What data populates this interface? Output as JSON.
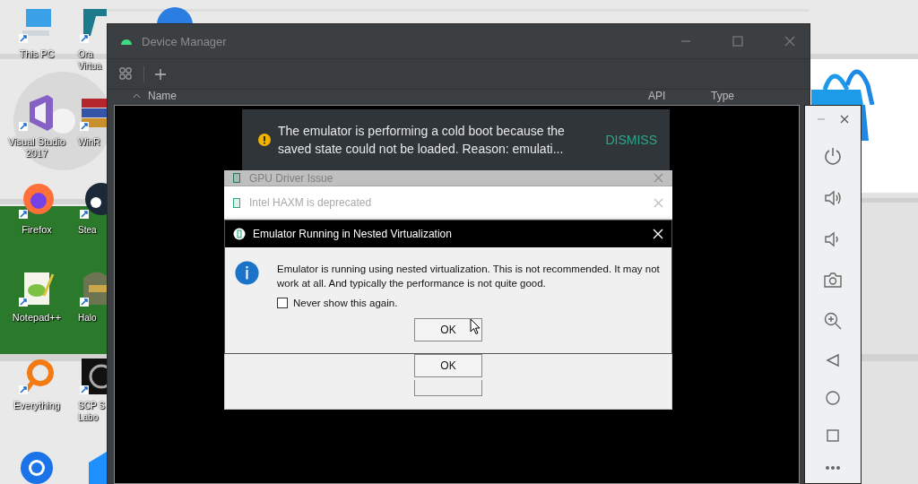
{
  "desktop_column_1": [
    {
      "kind": "pc",
      "label": "This PC"
    },
    {
      "kind": "vs",
      "label": "Visual Studio 2017"
    },
    {
      "kind": "firefox",
      "label": "Firefox"
    },
    {
      "kind": "notepad",
      "label": "Notepad++"
    },
    {
      "kind": "everything",
      "label": "Everything"
    },
    {
      "kind": "chrome"
    }
  ],
  "desktop_column_2": [
    {
      "kind": "vbox",
      "label": "Ora Virtua"
    },
    {
      "kind": "winrar",
      "label": "WinR"
    },
    {
      "kind": "steam",
      "label": "Stea"
    },
    {
      "kind": "halo",
      "label": "Halo"
    },
    {
      "kind": "scp",
      "label": "SCP S Labo"
    },
    {
      "kind": "tile"
    }
  ],
  "device_manager": {
    "title": "Device Manager",
    "columns": [
      "Name",
      "API",
      "Type"
    ]
  },
  "toast": {
    "message": "The emulator is performing a cold boot because the saved state could not be loaded. Reason: emulati...",
    "action": "DISMISS"
  },
  "background_dialogs": [
    {
      "title": "GPU Driver Issue"
    },
    {
      "title": "Intel HAXM is deprecated"
    }
  ],
  "dialog": {
    "title": "Emulator Running in Nested Virtualization",
    "message": "Emulator is running using nested virtualization. This is not recommended. It may not work at all. And typically the performance is not quite good.",
    "checkbox": {
      "label": "Never show this again.",
      "checked": false
    },
    "button": "OK"
  },
  "stacked_button": "OK"
}
